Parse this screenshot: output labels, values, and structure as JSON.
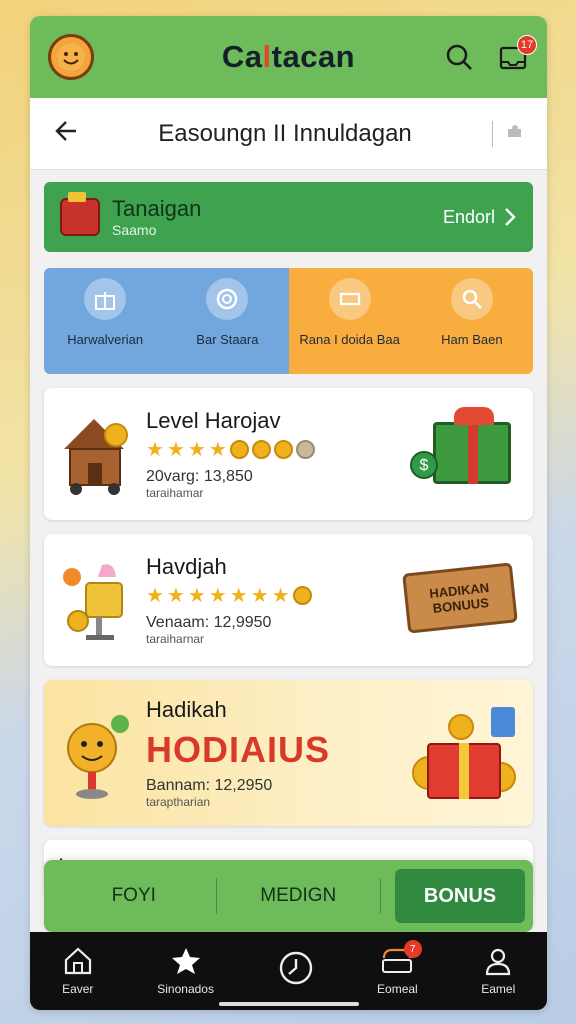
{
  "appbar": {
    "title_prefix": "Ca",
    "title_accent": "l",
    "title_rest": "tacan",
    "notification_count": "17"
  },
  "subheader": {
    "title": "Easoungn II Innuldagan"
  },
  "banner": {
    "title": "Tanaigan",
    "subtitle": "Saamo",
    "cta": "Endorl"
  },
  "categories": [
    {
      "label": "Harwalverian",
      "color": "#72a7dd"
    },
    {
      "label": "Bar Staara",
      "color": "#72a7dd"
    },
    {
      "label": "Rana I doida Baa",
      "color": "#f8ad3e"
    },
    {
      "label": "Ham Baen",
      "color": "#f8ad3e"
    }
  ],
  "cards": [
    {
      "name": "Level Harojav",
      "stats": "20varg: 13,850",
      "sub": "taraihamar",
      "stars_full": 4,
      "coins": 4
    },
    {
      "name": "Havdjah",
      "stats": "Venaam: 12,9950",
      "sub": "taraiharnar",
      "stars_full": 7,
      "coins": 1,
      "sign_text": "HADIKAN BONUUS"
    },
    {
      "name": "Hadikah",
      "headline": "HODIAIUS",
      "stats": "Bannam: 12,2950",
      "sub": "taraptharian"
    }
  ],
  "partial_card": {
    "name": "I "
  },
  "segments": {
    "opt1": "FOYI",
    "opt2": "MEDIGN",
    "opt3": "BONUS"
  },
  "bottom_nav": [
    {
      "label": "Eaver",
      "icon": "home-icon"
    },
    {
      "label": "Sinonados",
      "icon": "star-icon"
    },
    {
      "label": "",
      "icon": "clock-icon"
    },
    {
      "label": "Eomeal",
      "icon": "inbox-icon",
      "badge": "7"
    },
    {
      "label": "Eamel",
      "icon": "profile-icon"
    }
  ]
}
